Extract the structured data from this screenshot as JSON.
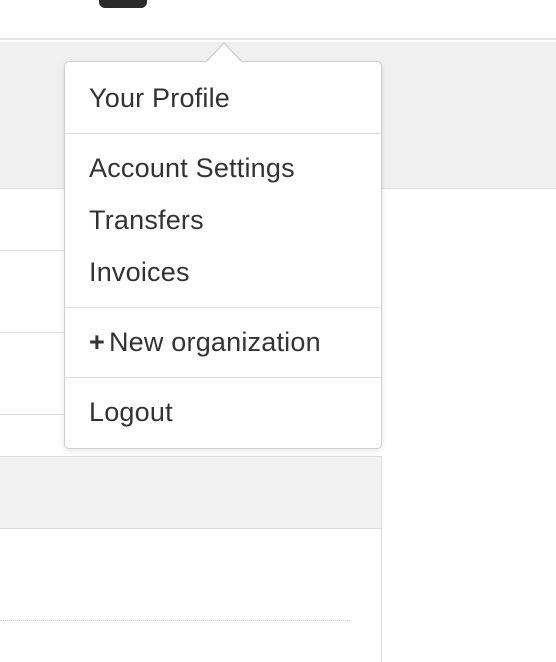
{
  "profile_menu": {
    "items": [
      {
        "label": "Your Profile"
      },
      {
        "label": "Account Settings"
      },
      {
        "label": "Transfers"
      },
      {
        "label": "Invoices"
      },
      {
        "label": "New organization",
        "icon": "plus-icon",
        "icon_glyph": "+"
      },
      {
        "label": "Logout"
      }
    ]
  },
  "colors": {
    "accent_green": "#5cb85c",
    "text": "#333333",
    "band": "#f0f0f0"
  }
}
